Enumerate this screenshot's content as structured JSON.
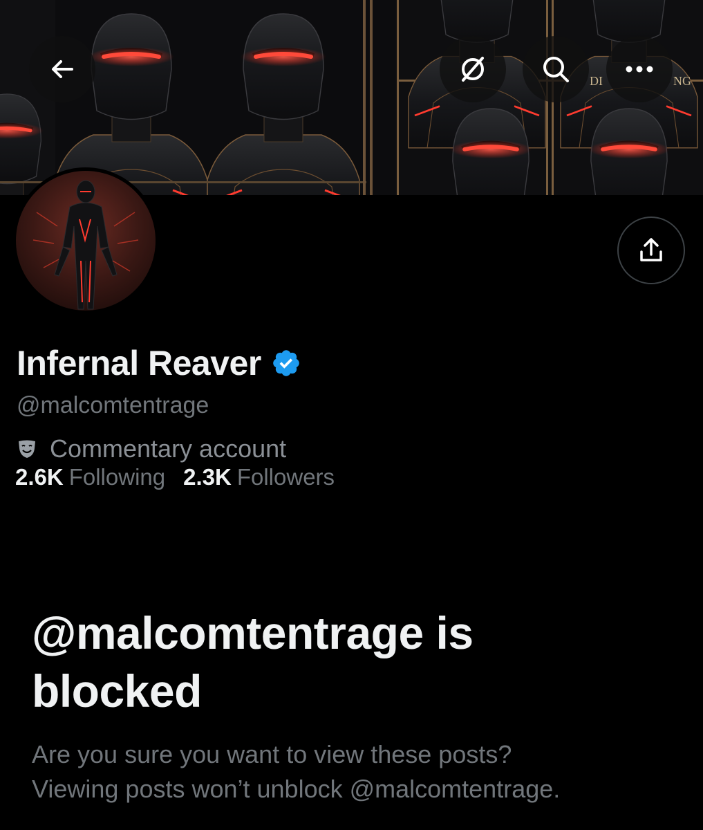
{
  "banner": {
    "text_fragments": [
      "DI",
      "NG"
    ]
  },
  "nav": {
    "back_icon": "arrow-left-icon",
    "mute_icon": "slashed-circle-icon",
    "search_icon": "search-icon",
    "more_icon": "more-horizontal-icon"
  },
  "profile": {
    "display_name": "Infernal Reaver",
    "handle": "@malcomtentrage",
    "label": "Commentary account",
    "following_count": "2.6K",
    "following_label": "Following",
    "followers_count": "2.3K",
    "followers_label": "Followers",
    "verified_color": "#1d9bf0"
  },
  "blocked": {
    "title": "@malcomtentrage is blocked",
    "description_line1": "Are you sure you want to view these posts?",
    "description_line2": "Viewing posts won’t unblock @malcomtentrage."
  },
  "colors": {
    "background": "#000000",
    "primary_text": "#f0f2f3",
    "secondary_text": "#71767b",
    "accent_red": "#ff3b2f"
  }
}
